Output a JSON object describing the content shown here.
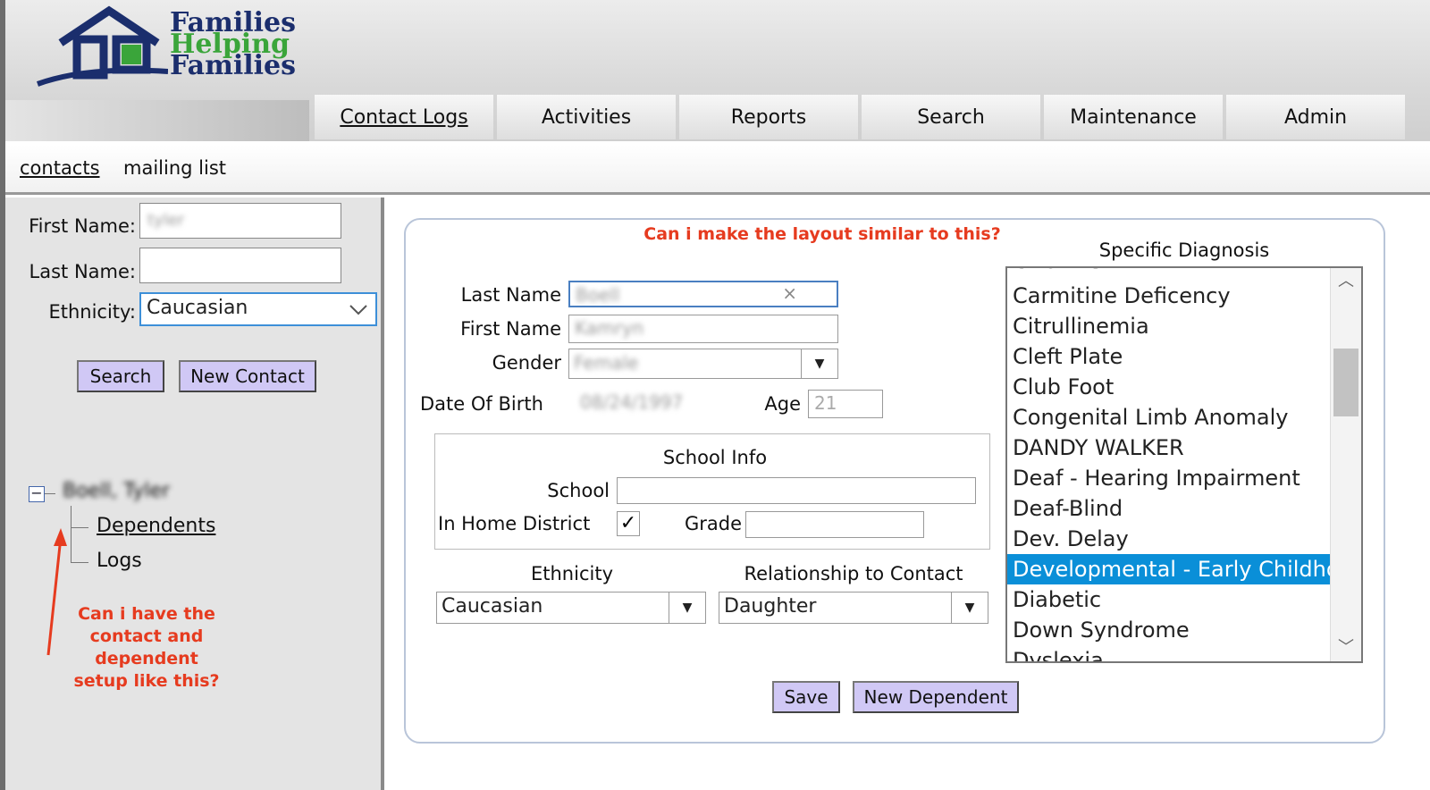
{
  "logo": {
    "line1": "Families",
    "line2": "Helping",
    "line3": "Families"
  },
  "nav": {
    "tabs": [
      "Contact Logs",
      "Activities",
      "Reports",
      "Search",
      "Maintenance",
      "Admin"
    ],
    "active": 0
  },
  "subnav": {
    "contacts": "contacts",
    "mailing": "mailing list"
  },
  "left": {
    "first_name_label": "First Name:",
    "first_name_value": "tyler",
    "last_name_label": "Last Name:",
    "last_name_value": "",
    "ethnicity_label": "Ethnicity:",
    "ethnicity_value": "Caucasian",
    "search_btn": "Search",
    "new_contact_btn": "New Contact",
    "tree_root": "Boell, Tyler",
    "tree_dependents": "Dependents",
    "tree_logs": "Logs",
    "annotation": "Can i have the contact and dependent setup like this?"
  },
  "form": {
    "annotation": "Can i make the layout similar to this?",
    "last_name_label": "Last Name",
    "last_name_value": "Boell",
    "first_name_label": "First Name",
    "first_name_value": "Kamryn",
    "gender_label": "Gender",
    "gender_value": "Female",
    "dob_label": "Date Of Birth",
    "dob_value": "08/24/1997",
    "age_label": "Age",
    "age_value": "21",
    "school_info_title": "School Info",
    "school_label": "School",
    "school_value": "",
    "in_home_label": "In Home District",
    "in_home_checked": true,
    "grade_label": "Grade",
    "grade_value": "",
    "ethnicity_label": "Ethnicity",
    "ethnicity_value": "Caucasian",
    "relationship_label": "Relationship to Contact",
    "relationship_value": "Daughter",
    "diagnosis_title": "Specific Diagnosis",
    "diagnosis_clipped_top": "CRONES",
    "diagnosis_items": [
      "Carmitine Deficency",
      "Citrullinemia",
      "Cleft Plate",
      "Club Foot",
      "Congenital Limb Anomaly",
      "DANDY WALKER",
      "Deaf - Hearing Impairment",
      "Deaf-Blind",
      "Dev. Delay",
      "Developmental - Early Childhood",
      "Diabetic",
      "Down Syndrome",
      "Dyslexia"
    ],
    "diagnosis_selected_index": 9,
    "save_btn": "Save",
    "new_dependent_btn": "New Dependent"
  },
  "colors": {
    "accent": "#0a8fd8",
    "button": "#d0c8f5",
    "annotation": "#e63b1f"
  },
  "icons": {
    "clear": "close-icon",
    "dropdown": "chevron-down-icon",
    "check": "check-icon"
  }
}
